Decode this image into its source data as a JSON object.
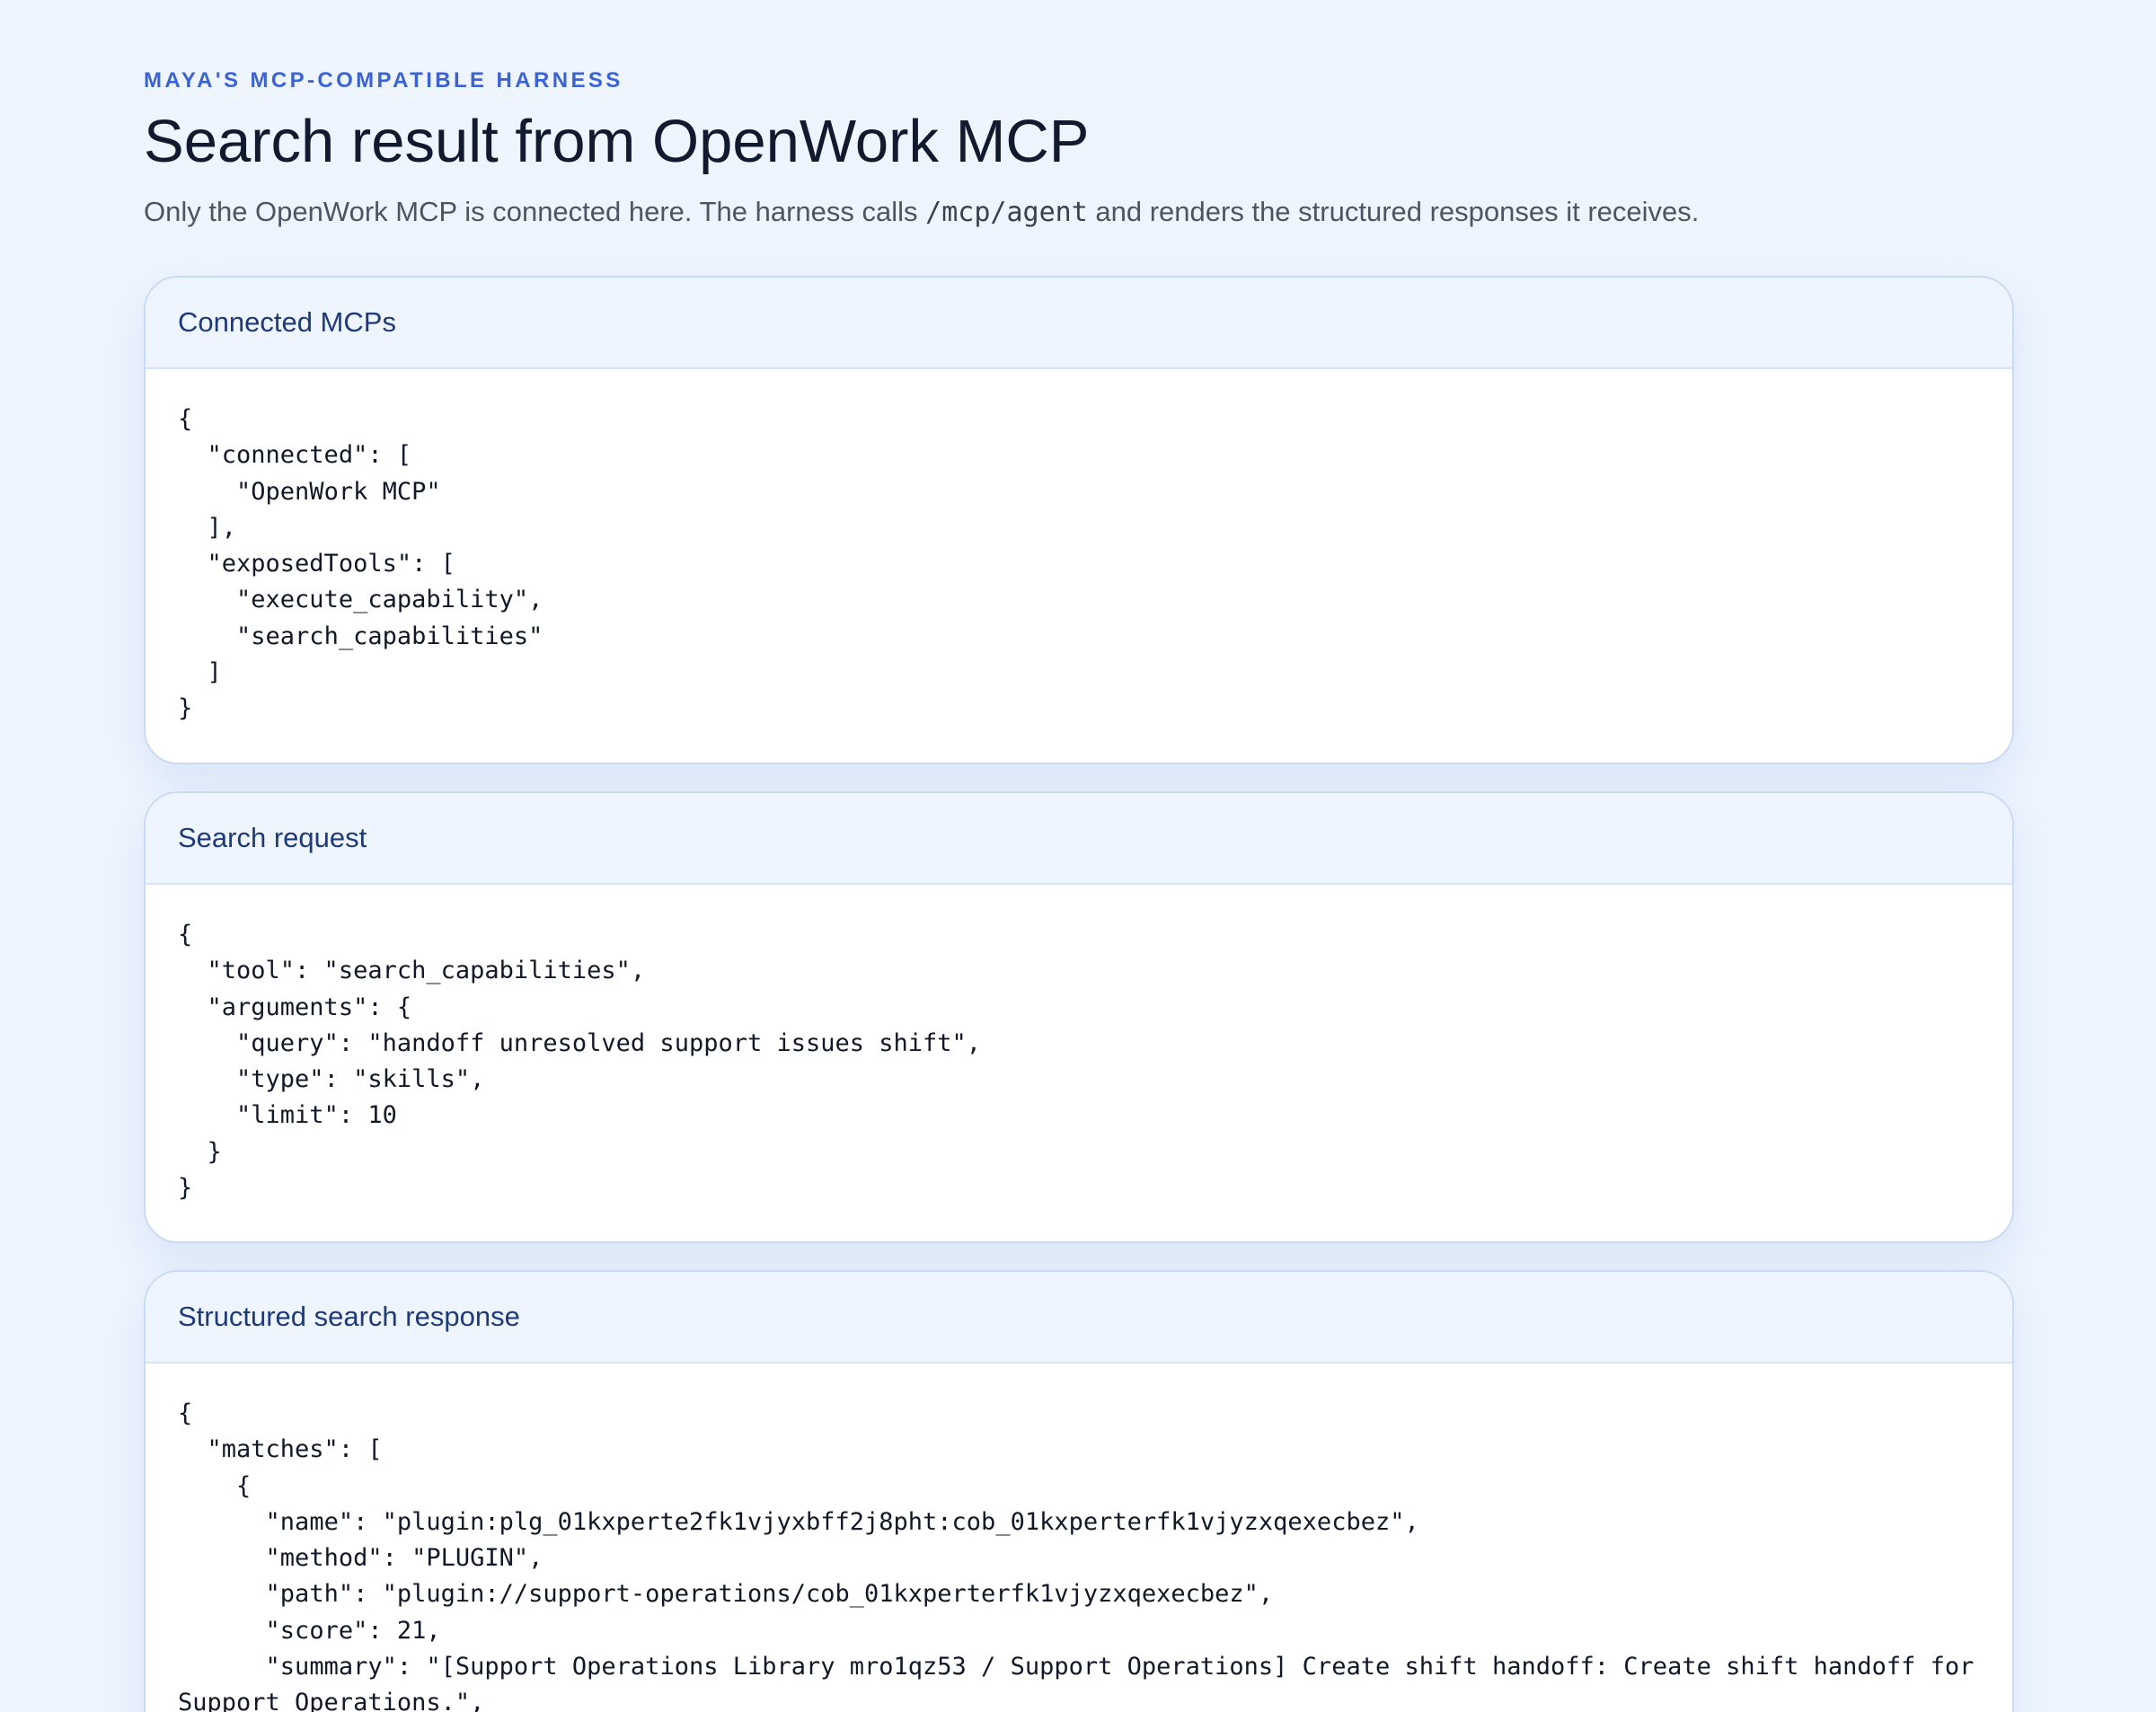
{
  "header": {
    "eyebrow": "MAYA'S MCP-COMPATIBLE HARNESS",
    "title": "Search result from OpenWork MCP",
    "subtitle_before": "Only the OpenWork MCP is connected here. The harness calls ",
    "subtitle_code": "/mcp/agent",
    "subtitle_after": " and renders the structured responses it receives."
  },
  "panels": {
    "connected": {
      "title": "Connected MCPs",
      "body": "{\n  \"connected\": [\n    \"OpenWork MCP\"\n  ],\n  \"exposedTools\": [\n    \"execute_capability\",\n    \"search_capabilities\"\n  ]\n}"
    },
    "request": {
      "title": "Search request",
      "body": "{\n  \"tool\": \"search_capabilities\",\n  \"arguments\": {\n    \"query\": \"handoff unresolved support issues shift\",\n    \"type\": \"skills\",\n    \"limit\": 10\n  }\n}"
    },
    "response": {
      "title": "Structured search response",
      "body": "{\n  \"matches\": [\n    {\n      \"name\": \"plugin:plg_01kxperte2fk1vjyxbff2j8pht:cob_01kxperterfk1vjyzxqexecbez\",\n      \"method\": \"PLUGIN\",\n      \"path\": \"plugin://support-operations/cob_01kxperterfk1vjyzxqexecbez\",\n      \"score\": 21,\n      \"summary\": \"[Support Operations Library mro1qz53 / Support Operations] Create shift handoff: Create shift handoff for Support Operations.\","
    }
  }
}
